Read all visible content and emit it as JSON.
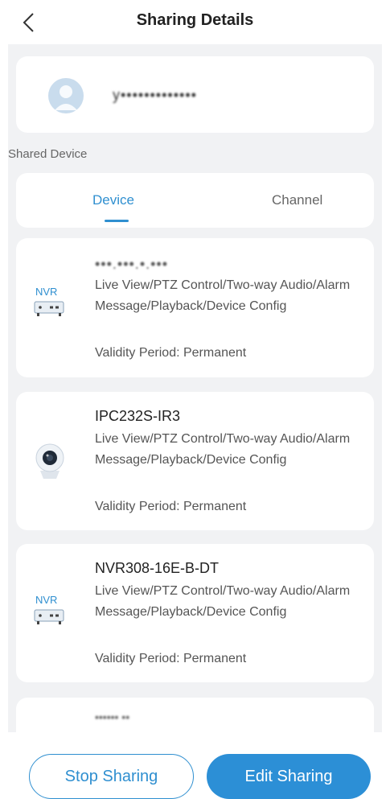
{
  "header": {
    "title": "Sharing Details"
  },
  "user": {
    "name": "y•••••••••••••"
  },
  "section_label": "Shared Device",
  "tabs": [
    {
      "label": "Device",
      "active": true
    },
    {
      "label": "Channel",
      "active": false
    }
  ],
  "devices": [
    {
      "icon": "nvr-icon",
      "icon_text": "NVR",
      "name": "•••.•••.•.•••",
      "permissions": "Live View/PTZ Control/Two-way Audio/Alarm Message/Playback/Device Config",
      "validity": "Validity Period:  Permanent"
    },
    {
      "icon": "camera-icon",
      "name": "IPC232S-IR3",
      "permissions": "Live View/PTZ Control/Two-way Audio/Alarm Message/Playback/Device Config",
      "validity": "Validity Period:  Permanent"
    },
    {
      "icon": "nvr-icon",
      "icon_text": "NVR",
      "name": "NVR308-16E-B-DT",
      "permissions": "Live View/PTZ Control/Two-way Audio/Alarm Message/Playback/Device Config",
      "validity": "Validity Period:  Permanent"
    },
    {
      "name": "•••••• ••"
    }
  ],
  "buttons": {
    "stop": "Stop Sharing",
    "edit": "Edit Sharing"
  },
  "colors": {
    "accent": "#2f8fd0",
    "background": "#f1f2f4"
  }
}
